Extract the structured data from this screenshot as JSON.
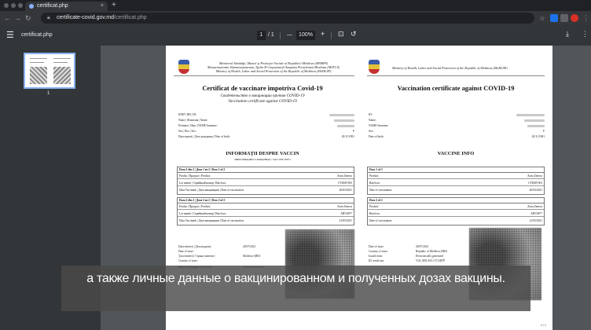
{
  "browser": {
    "tab_title": "certificat.php",
    "tab_close": "×",
    "new_tab": "+",
    "url_host": "certificate-covid.gov.md",
    "url_path": "/certificat.php"
  },
  "pdf_toolbar": {
    "menu_icon": "☰",
    "file_name": "certificat.php",
    "page_current": "1",
    "page_total": "/ 1",
    "zoom_out": "—",
    "zoom": "100%",
    "zoom_in": "+",
    "fit_icon": "⊡",
    "rotate_icon": "↺",
    "download_icon": "⤓",
    "more_icon": "⋮"
  },
  "sidebar": {
    "thumb_page_number": "1"
  },
  "certificate_ro": {
    "ministry_ro": "Ministerul Sănătăţii, Muncii şi Protecţiei Sociale al Republicii Moldova (MSMPS)",
    "ministry_ru": "Министерство Здравоохранения, Труда И Социальной Защиты Республики Молдова (МЗТСЗ)",
    "ministry_en": "Ministry of Health, Labor and Social Protection of the Republic of Moldova (MoHLSP)",
    "title": "Certificat de vaccinare impotriva Covid-19",
    "subtitle_ru": "Свидетельство о вакцинации против COVID-19",
    "subtitle_en": "Vaccination certificate against COVID-19",
    "fields": [
      {
        "label": "IDNP | ВН | ID:",
        "value": ""
      },
      {
        "label": "Nume | Фамилия | Name:",
        "value": ""
      },
      {
        "label": "Prenume | Имя | NAME Surname:",
        "value": ""
      },
      {
        "label": "Sex | Пол | Sex:",
        "value": "F"
      },
      {
        "label": "Data naşterii | Дата рождения | Date of birth:",
        "value": "20/11/1981"
      }
    ],
    "vaccine_section": "INFORMAŢII DESPRE VACCIN",
    "vaccine_section_sub": "ИНФОРМАЦИЯ О ВАКЦИНАХ | VACCINE INFO",
    "dose1_header": "Doza 1 din 2 | Доза 1 из 2 | Dose 1 of 2",
    "dose2_header": "Doza 2 din 2 | Доза 2 из 2 | Dose 2 of 2",
    "dose_rows": [
      {
        "label": "Produs | Продукт | Product:",
        "d1": "Astra Zeneca",
        "d2": "Astra Zeneca"
      },
      {
        "label": "Lot număr | Серийный номер | Batch no:",
        "d1": "CTMAV503",
        "d2": "ABV4877"
      },
      {
        "label": "Data Vaccinării | Дата вакцинации | Date of vaccination:",
        "d1": "26/03/2021",
        "d2": "21/05/2021"
      }
    ],
    "issue_fields": [
      {
        "label": "Data emiterii | Дата выдачи |",
        "value": "28/07/2021"
      },
      {
        "label": "Date of issue:",
        "value": ""
      },
      {
        "label": "Ţara emiterii | Страна эмитент |",
        "value": "Moldova (MD)"
      },
      {
        "label": "Country of issue:",
        "value": ""
      },
      {
        "label": "Emis de | Выдано из | Issued",
        "value": "Generat electronic"
      }
    ]
  },
  "certificate_en": {
    "ministry": "Ministry of Health, Labor and Social Protection of the Republic of Moldova (MoHLSP)",
    "title": "Vaccination certificate against COVID-19",
    "fields": [
      {
        "label": "ID:",
        "value": ""
      },
      {
        "label": "Name:",
        "value": ""
      },
      {
        "label": "NAME Surname:",
        "value": ""
      },
      {
        "label": "Sex:",
        "value": "F"
      },
      {
        "label": "Date of birth:",
        "value": "20/11/1981"
      }
    ],
    "vaccine_section": "VACCINE INFO",
    "dose1_header": "Dose 1 of 2",
    "dose2_header": "Dose 2 of 2",
    "dose_rows": [
      {
        "label": "Product:",
        "d1": "Astra Zeneca",
        "d2": "Astra Zeneca"
      },
      {
        "label": "Batch no:",
        "d1": "CTMAV503",
        "d2": "ABV4877"
      },
      {
        "label": "Date of vaccination:",
        "d1": "26/03/2021",
        "d2": "21/05/2021"
      }
    ],
    "issue_fields": [
      {
        "label": "Date of issue:",
        "value": "28/07/2021"
      },
      {
        "label": "Country of issue:",
        "value": "Republic of Moldova (MD)"
      },
      {
        "label": "Issued from:",
        "value": "Electronically generated"
      },
      {
        "label": "ID certificate:",
        "value": "VGL.MD.A01.17C3487P"
      }
    ]
  },
  "page_footer": "1 / 1",
  "subtitle_caption": "а также личные данные о вакцинированном и полученных дозах вакцины."
}
